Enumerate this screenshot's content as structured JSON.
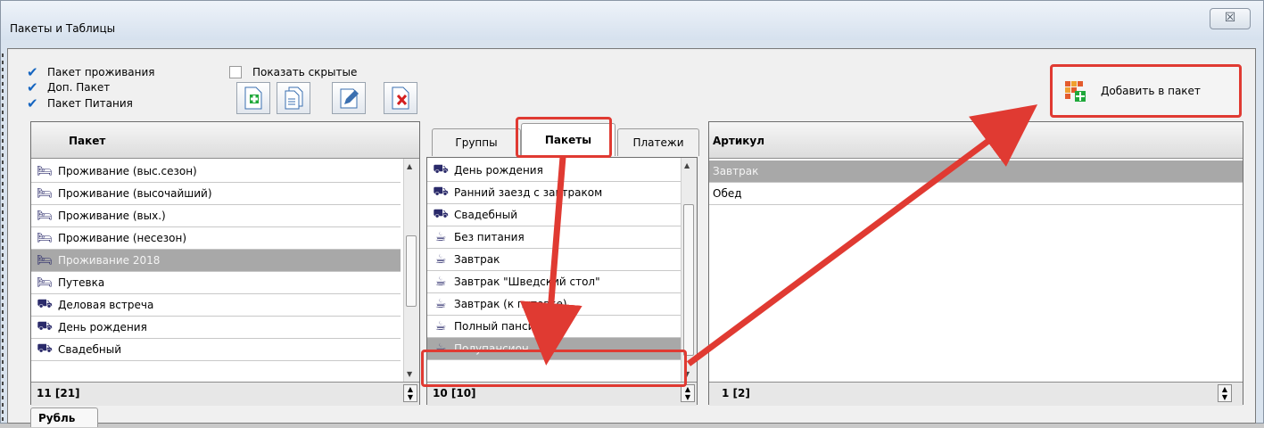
{
  "window": {
    "title": "Пакеты и Таблицы",
    "close_glyph": "☒"
  },
  "checks": [
    {
      "label": "Пакет проживания",
      "checked": true
    },
    {
      "label": "Доп. Пакет",
      "checked": true
    },
    {
      "label": "Пакет Питания",
      "checked": true
    }
  ],
  "show_hidden": {
    "label": "Показать скрытые",
    "checked": false
  },
  "toolbar": [
    "add-document-icon",
    "copy-document-icon",
    "edit-document-icon",
    "delete-document-icon"
  ],
  "add_to_package": {
    "label": "Добавить в пакет",
    "icon": "grid-add-icon"
  },
  "left": {
    "header": "Пакет",
    "rows": [
      {
        "icon": "bed-icon",
        "label": "Проживание (выс.сезон)"
      },
      {
        "icon": "bed-icon",
        "label": "Проживание (высочайший)"
      },
      {
        "icon": "bed-icon",
        "label": "Проживание (вых.)"
      },
      {
        "icon": "bed-icon",
        "label": "Проживание (несезон)"
      },
      {
        "icon": "bed-icon",
        "label": "Проживание 2018",
        "selected": true
      },
      {
        "icon": "bed-icon",
        "label": "Путевка"
      },
      {
        "icon": "cart-icon",
        "label": "Деловая встреча"
      },
      {
        "icon": "cart-icon",
        "label": "День рождения"
      },
      {
        "icon": "cart-icon",
        "label": "Свадебный"
      }
    ],
    "footer": "11 [21]"
  },
  "middle": {
    "tabs": [
      "Группы",
      "Пакеты",
      "Платежи"
    ],
    "active_tab": "Пакеты",
    "rows": [
      {
        "icon": "cart-icon",
        "label": "День рождения"
      },
      {
        "icon": "cart-icon",
        "label": "Ранний заезд с завтраком"
      },
      {
        "icon": "cart-icon",
        "label": "Свадебный"
      },
      {
        "icon": "cup-icon",
        "label": "Без питания"
      },
      {
        "icon": "cup-icon",
        "label": "Завтрак"
      },
      {
        "icon": "cup-icon",
        "label": "Завтрак \"Шведский стол\""
      },
      {
        "icon": "cup-icon",
        "label": "Завтрак (к путевке)"
      },
      {
        "icon": "cup-icon",
        "label": "Полный пансион"
      },
      {
        "icon": "cup-icon",
        "label": "Полупансион",
        "selected": true
      }
    ],
    "footer": "10 [10]"
  },
  "right": {
    "header": "Артикул",
    "rows": [
      {
        "label": "Завтрак",
        "selected": true
      },
      {
        "label": "Обед"
      }
    ],
    "footer": "1 [2]"
  },
  "bottom_tab": "Рубль",
  "colors": {
    "annotation": "#e03a32",
    "selection": "#a8a8a8",
    "check": "#1565c0"
  }
}
